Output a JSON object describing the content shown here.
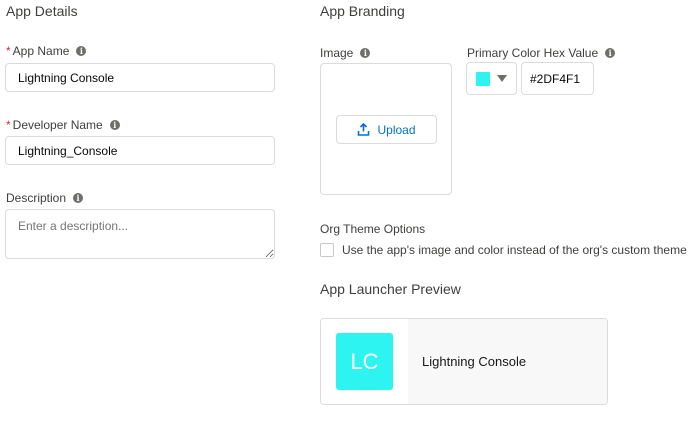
{
  "app_details": {
    "title": "App Details",
    "app_name": {
      "label": "App Name",
      "required_marker": "*",
      "value": "Lightning Console"
    },
    "developer_name": {
      "label": "Developer Name",
      "required_marker": "*",
      "value": "Lightning_Console"
    },
    "description": {
      "label": "Description",
      "placeholder": "Enter a description..."
    }
  },
  "app_branding": {
    "title": "App Branding",
    "image": {
      "label": "Image",
      "upload_label": "Upload"
    },
    "primary_color": {
      "label": "Primary Color Hex Value",
      "value": "#2DF4F1",
      "swatch_color": "#2DF4F1"
    },
    "org_theme": {
      "label": "Org Theme Options",
      "checkbox_label": "Use the app's image and color instead of the org's custom theme",
      "checked": false
    }
  },
  "launcher_preview": {
    "title": "App Launcher Preview",
    "initials": "LC",
    "app_name": "Lightning Console",
    "tile_color": "#2DF4F1"
  },
  "colors": {
    "link": "#0070d2",
    "required": "#c23934",
    "border": "#dddbda"
  }
}
